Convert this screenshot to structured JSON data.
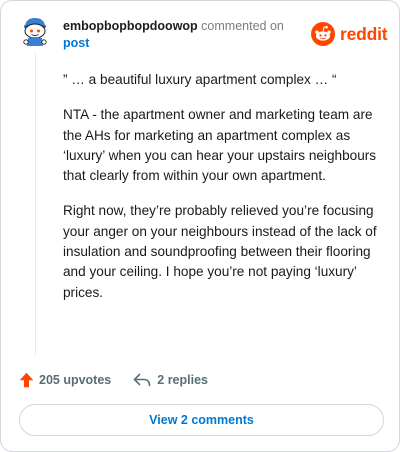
{
  "header": {
    "username": "embopbopbopdoowop",
    "action_text": "commented on",
    "post_link": "post"
  },
  "brand": {
    "name": "reddit",
    "logo_icon": "reddit-alien-icon",
    "color": "#ff4500"
  },
  "comment": {
    "paragraphs": [
      "” … a beautiful luxury apartment complex … “",
      "NTA - the apartment owner and marketing team are the AHs for marketing an apartment complex as ‘luxury’ when you can hear your upstairs neighbours that clearly from within your own apartment.",
      "Right now, they’re probably relieved you’re focusing your anger on your neighbours instead of the lack of insulation and soundproofing between their flooring and your ceiling. I hope you’re not paying ‘luxury’ prices."
    ]
  },
  "footer": {
    "upvotes": "205 upvotes",
    "upvote_icon": "upvote-arrow-icon",
    "replies": "2 replies",
    "reply_icon": "reply-arrow-icon",
    "upvote_color": "#ff4500"
  },
  "view_comments": {
    "label": "View 2 comments"
  },
  "colors": {
    "link": "#0079d3",
    "muted": "#576f76",
    "border": "#d3d6da"
  }
}
